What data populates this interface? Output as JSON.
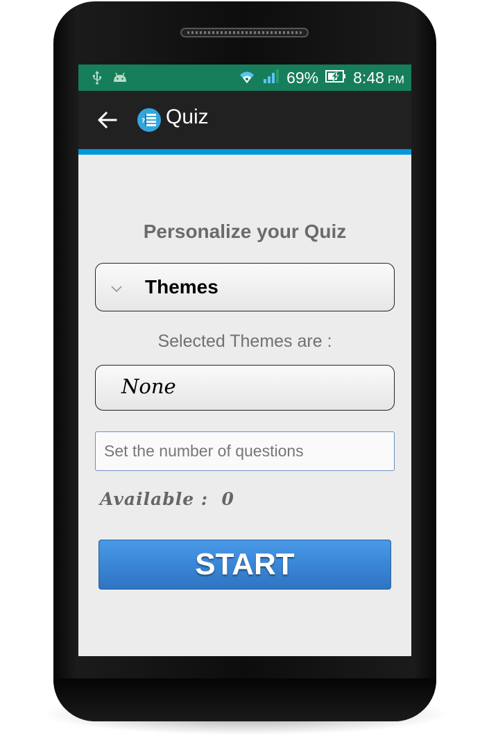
{
  "status_bar": {
    "battery_percent": "69%",
    "time": "8:48",
    "ampm": "PM",
    "icons": [
      "usb-icon",
      "android-icon",
      "wifi-icon",
      "signal-icon",
      "battery-charging-icon"
    ],
    "background_color": "#167e5a"
  },
  "action_bar": {
    "title": "Quiz",
    "back_icon": "back-arrow-icon",
    "app_icon": "quiz-app-icon",
    "accent_color": "#0099dd"
  },
  "main": {
    "heading": "Personalize your Quiz",
    "themes_spinner": {
      "label": "Themes",
      "icon": "chevron-down-icon"
    },
    "selected_label": "Selected Themes are :",
    "selected_value": "None",
    "question_count_input": {
      "value": "",
      "placeholder": "Set the number of questions"
    },
    "available": "Available :  0",
    "start_button": "START",
    "start_button_color": "#3a86d6"
  }
}
